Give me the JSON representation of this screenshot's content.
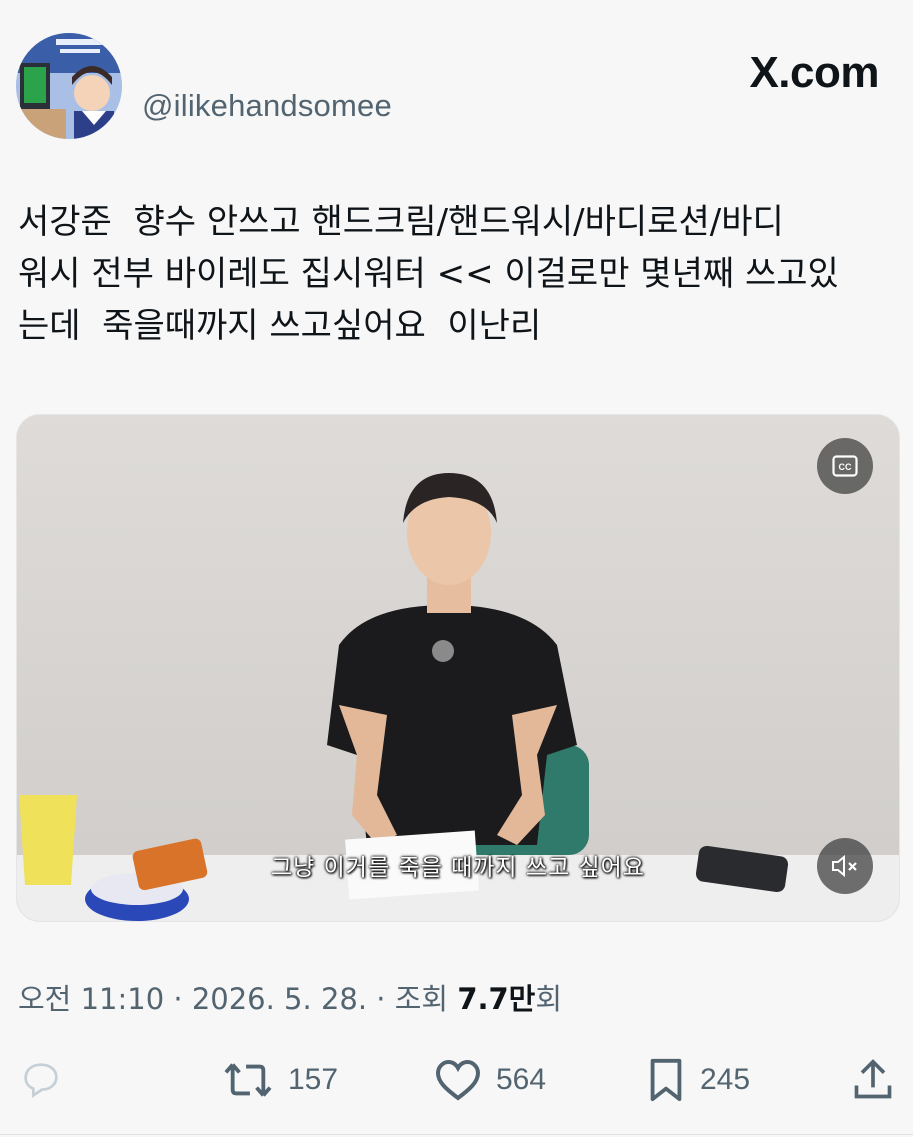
{
  "header": {
    "handle": "@ilikehandsomee",
    "brand": "X.com"
  },
  "tweet": {
    "text": "서강준  향수 안쓰고 핸드크림/핸드워시/바디로션/바디\n워시 전부 바이레도 집시워터 << 이걸로만 몇년째 쓰고있\n는데  죽을때까지 쓰고싶어요  이난리"
  },
  "media": {
    "subtitle": "그냥 이거를 죽을 때까지 쓰고 싶어요",
    "cc_icon": "closed-captions-icon",
    "mute_icon": "speaker-muted-icon"
  },
  "meta": {
    "time": "오전 11:10",
    "separator": " · ",
    "date": "2026. 5. 28.",
    "views_label": "조회",
    "views_number": "7.7만",
    "views_suffix": "회"
  },
  "actions": {
    "reply_count": "",
    "retweet_count": "157",
    "like_count": "564",
    "bookmark_count": "245"
  },
  "colors": {
    "background": "#f7f7f7",
    "text": "#0f1419",
    "secondary": "#536471"
  }
}
